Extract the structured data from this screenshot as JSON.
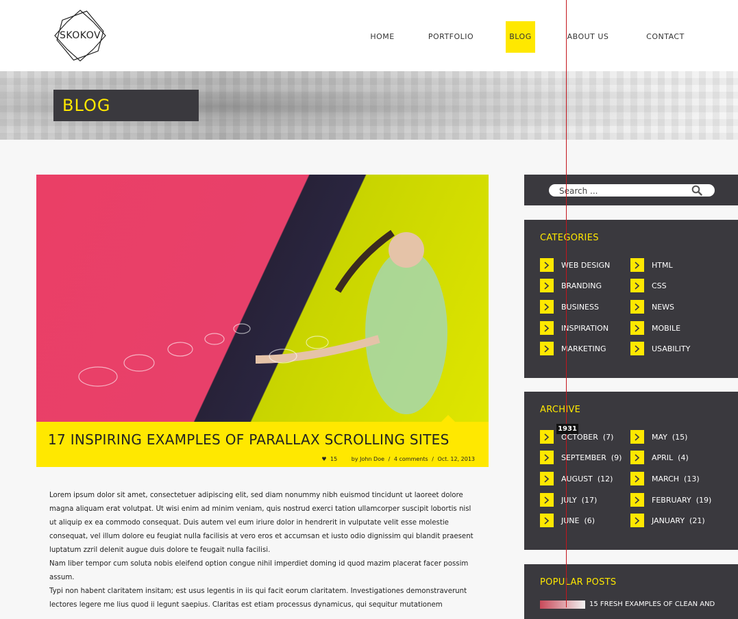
{
  "logo": {
    "text": "SKOKOV"
  },
  "nav": {
    "items": [
      {
        "label": "HOME",
        "active": false
      },
      {
        "label": "PORTFOLIO",
        "active": false
      },
      {
        "label": "BLOG",
        "active": true
      },
      {
        "label": "ABOUT US",
        "active": false
      },
      {
        "label": "CONTACT",
        "active": false
      }
    ]
  },
  "banner": {
    "title": "BLOG"
  },
  "post": {
    "title": "17 INSPIRING EXAMPLES OF PARALLAX SCROLLING SITES",
    "likes": "15",
    "author": "by John Doe",
    "comments": "4 comments",
    "date": "Oct. 12, 2013",
    "paragraphs": [
      "Lorem ipsum dolor sit amet, consectetuer adipiscing elit, sed diam nonummy nibh euismod tincidunt ut laoreet dolore magna aliquam erat volutpat. Ut wisi enim ad minim veniam, quis nostrud exerci tation ullamcorper suscipit lobortis nisl ut aliquip ex ea commodo consequat. Duis autem vel eum iriure dolor in hendrerit in vulputate velit esse molestie consequat, vel illum dolore eu feugiat nulla facilisis at vero eros et accumsan et iusto odio dignissim qui blandit praesent luptatum zzril delenit augue duis dolore te feugait nulla facilisi.",
      "Nam liber tempor cum soluta nobis eleifend option congue nihil imperdiet doming id quod mazim placerat facer possim assum.",
      "Typi non habent claritatem insitam; est usus legentis in iis qui facit eorum claritatem. Investigationes demonstraverunt lectores legere me lius quod ii legunt saepius. Claritas est etiam processus dynamicus, qui sequitur mutationem"
    ]
  },
  "search": {
    "placeholder": "Search ..."
  },
  "categories": {
    "title": "CATEGORIES",
    "left": [
      "WEB DESIGN",
      "BRANDING",
      "BUSINESS",
      "INSPIRATION",
      "MARKETING"
    ],
    "right": [
      "HTML",
      "CSS",
      "NEWS",
      "MOBILE",
      "USABILITY"
    ]
  },
  "archive": {
    "title": "ARCHIVE",
    "left": [
      "OCTOBER  (7)",
      "SEPTEMBER  (9)",
      "AUGUST  (12)",
      "JULY  (17)",
      "JUNE  (6)"
    ],
    "right": [
      "MAY  (15)",
      "APRIL  (4)",
      "MARCH  (13)",
      "FEBRUARY  (19)",
      "JANUARY  (21)"
    ]
  },
  "popular": {
    "title": "POPULAR POSTS",
    "first_post": "15 FRESH EXAMPLES OF CLEAN AND"
  },
  "overlay": {
    "badge": "1931"
  },
  "colors": {
    "accent": "#ffe800",
    "dark": "#3a393e",
    "guide": "#c4151c"
  }
}
